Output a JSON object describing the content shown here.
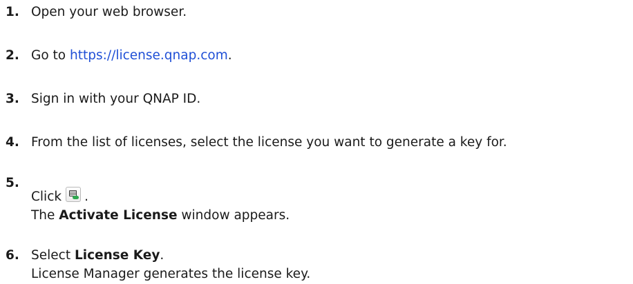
{
  "steps": [
    {
      "number": "1.",
      "text": "Open your web browser."
    },
    {
      "number": "2.",
      "prefix": "Go to ",
      "link": "https://license.qnap.com",
      "suffix": "."
    },
    {
      "number": "3.",
      "text": "Sign in with your QNAP ID."
    },
    {
      "number": "4.",
      "text": "From the list of licenses, select the license you want to generate a key for."
    },
    {
      "number": "5.",
      "prefix": "Click",
      "icon": "activate-license-icon",
      "suffix": ".",
      "result_prefix": "The ",
      "result_bold": "Activate License",
      "result_suffix": " window appears."
    },
    {
      "number": "6.",
      "prefix": "Select ",
      "bold": "License Key",
      "suffix": ".",
      "result": "License Manager generates the license key."
    }
  ]
}
